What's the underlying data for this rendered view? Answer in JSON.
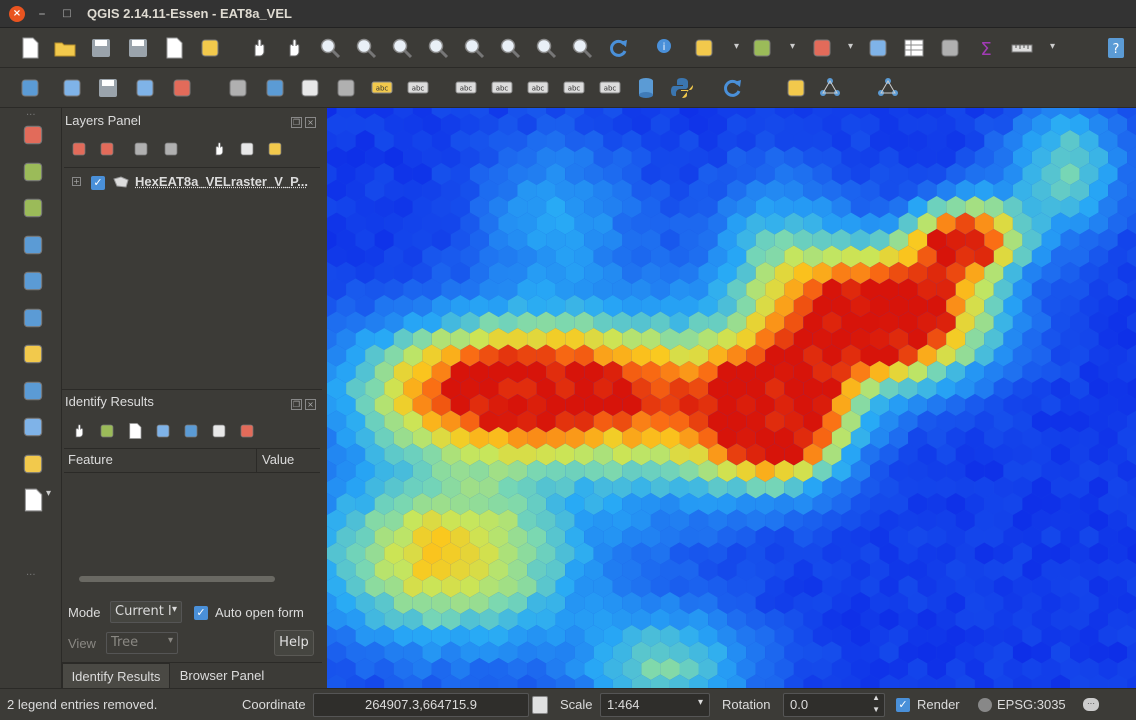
{
  "window": {
    "title": "QGIS 2.14.11-Essen - EAT8a_VEL",
    "close": "×",
    "minimize": "–",
    "maximize": "□"
  },
  "layers_panel": {
    "title": "Layers Panel",
    "layer": {
      "name": "HexEAT8a_VELraster_V_P...",
      "checked": true
    }
  },
  "identify_panel": {
    "title": "Identify Results",
    "col_feature": "Feature",
    "col_value": "Value",
    "mode_label": "Mode",
    "mode_value": "Current l",
    "auto_open_form": "Auto open form",
    "view_label": "View",
    "view_value": "Tree",
    "help": "Help",
    "tabs": [
      "Identify Results",
      "Browser Panel"
    ]
  },
  "status": {
    "message": "2 legend entries removed.",
    "coordinate_label": "Coordinate",
    "coordinate_value": "264907.3,664715.9",
    "scale_label": "Scale",
    "scale_value": "1:464",
    "rotation_label": "Rotation",
    "rotation_value": "0.0",
    "render_label": "Render",
    "crs": "EPSG:3035"
  },
  "colors": {
    "accent": "#e95420",
    "check": "#4a90d9",
    "map_bg": "#1f4fe0"
  },
  "icons": {
    "toolbar1": [
      "new-project-icon",
      "open-project-icon",
      "save-project-icon",
      "save-as-icon",
      "new-print-composer-icon",
      "composer-manager-icon",
      "pan-icon",
      "pan-to-selection-icon",
      "zoom-in-icon",
      "zoom-out-icon",
      "zoom-actual-icon",
      "zoom-full-icon",
      "zoom-to-selection-icon",
      "zoom-to-layer-icon",
      "zoom-last-icon",
      "zoom-next-icon",
      "refresh-icon",
      "identify-icon",
      "run-feature-action-icon",
      "select-features-icon",
      "select-by-expression-icon",
      "deselect-all-icon",
      "attribute-table-icon",
      "field-calculator-icon",
      "statistics-icon",
      "measure-icon",
      "help-icon"
    ],
    "toolbar2": [
      "digitize-current-edits-icon",
      "toggle-editing-icon",
      "save-edits-icon",
      "add-feature-icon",
      "node-tool-icon",
      "delete-selected-icon",
      "cut-features-icon",
      "copy-features-icon",
      "paste-features-icon",
      "label-icon",
      "label-pin-icon",
      "label-highlight-icon",
      "label-show-hide-icon",
      "label-move-icon",
      "label-rotate-icon",
      "label-change-icon",
      "db-manager-icon",
      "python-console-icon",
      "undo-icon",
      "geoprocessing-icon",
      "add-topology-icon",
      "topology-checker-icon"
    ],
    "left": [
      "add-vector-layer-icon",
      "add-raster-layer-icon",
      "add-postgis-layer-icon",
      "add-spatialite-layer-icon",
      "add-mssql-layer-icon",
      "add-wms-layer-icon",
      "add-wcs-layer-icon",
      "add-wfs-layer-icon",
      "add-delimited-text-icon",
      "add-virtual-layer-icon",
      "new-shapefile-icon"
    ]
  }
}
